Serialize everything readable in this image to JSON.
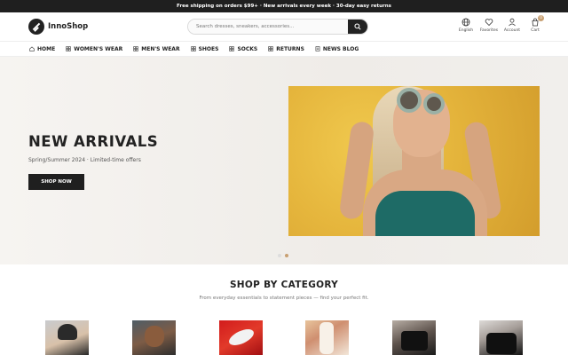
{
  "announcement": "Free shipping on orders $99+ · New arrivals every week · 30-day easy returns",
  "brand": {
    "name": "InnoShop"
  },
  "search": {
    "placeholder": "Search dresses, sneakers, accessories..."
  },
  "header_icons": [
    {
      "label": "English",
      "icon": "globe-icon"
    },
    {
      "label": "Favorites",
      "icon": "heart-icon"
    },
    {
      "label": "Account",
      "icon": "user-icon"
    },
    {
      "label": "Cart",
      "icon": "cart-icon",
      "badge": "0"
    }
  ],
  "nav": [
    {
      "label": "HOME",
      "icon": "home-icon"
    },
    {
      "label": "WOMEN'S WEAR",
      "icon": "grid-icon"
    },
    {
      "label": "MEN'S WEAR",
      "icon": "grid-icon"
    },
    {
      "label": "SHOES",
      "icon": "grid-icon"
    },
    {
      "label": "SOCKS",
      "icon": "grid-icon"
    },
    {
      "label": "RETURNS",
      "icon": "grid-icon"
    },
    {
      "label": "NEWS BLOG",
      "icon": "blog-icon"
    }
  ],
  "hero": {
    "title": "NEW ARRIVALS",
    "subtitle": "Spring/Summer 2024 · Limited-time offers",
    "button": "SHOP NOW",
    "slide_count": 2,
    "active_slide": 2
  },
  "categories": {
    "title": "SHOP BY CATEGORY",
    "subtitle": "From everyday essentials to statement pieces — find your perfect fit."
  },
  "colors": {
    "accent": "#c8a072",
    "dark": "#1f1f1f"
  }
}
